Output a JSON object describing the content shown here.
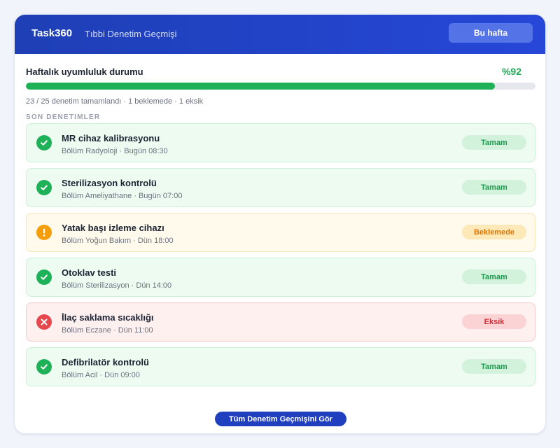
{
  "header": {
    "brand": "Task360",
    "subtitle": "Tıbbi Denetim Geçmişi",
    "week_button": "Bu hafta"
  },
  "progress": {
    "title": "Haftalık uyumluluk durumu",
    "percent_label": "%92",
    "percent": 92,
    "stats": "23 / 25 denetim tamamlandı · 1 beklemede · 1 eksik"
  },
  "section_label": "SON DENETIMLER",
  "colors": {
    "accent": "#2647d8",
    "ok": "#1fb157",
    "pending": "#f59e0b",
    "missing": "#e5484d"
  },
  "audits": [
    {
      "title": "MR cihaz kalibrasyonu",
      "meta": "Bölüm Radyoloji · Bugün 08:30",
      "status": "ok",
      "status_label": "Tamam",
      "icon": "check-circle-icon"
    },
    {
      "title": "Sterilizasyon kontrolü",
      "meta": "Bölüm Ameliyathane · Bugün 07:00",
      "status": "ok",
      "status_label": "Tamam",
      "icon": "check-circle-icon"
    },
    {
      "title": "Yatak başı izleme cihazı",
      "meta": "Bölüm Yoğun Bakım · Dün 18:00",
      "status": "pending",
      "status_label": "Beklemede",
      "icon": "warning-circle-icon"
    },
    {
      "title": "Otoklav testi",
      "meta": "Bölüm Sterilizasyon · Dün 14:00",
      "status": "ok",
      "status_label": "Tamam",
      "icon": "check-circle-icon"
    },
    {
      "title": "İlaç saklama sıcaklığı",
      "meta": "Bölüm Eczane · Dün 11:00",
      "status": "missing",
      "status_label": "Eksik",
      "icon": "error-circle-icon"
    },
    {
      "title": "Defibrilatör kontrolü",
      "meta": "Bölüm Acil · Dün 09:00",
      "status": "ok",
      "status_label": "Tamam",
      "icon": "check-circle-icon"
    }
  ],
  "footer": {
    "all_button": "Tüm Denetim Geçmişini Gör"
  }
}
